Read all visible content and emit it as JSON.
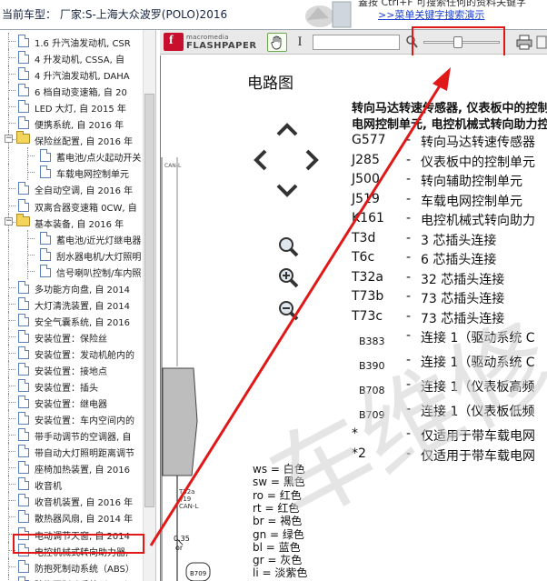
{
  "header": {
    "car_title": "当前车型：  厂家:S-上海大众波罗(POLO)2016",
    "hint_line": "蓋按 Ctrl+F  可搜索任何的资料关键字",
    "hint_link": ">>菜单关键字搜索演示"
  },
  "tree": {
    "items": [
      {
        "label": "1.6 升汽油发动机, CSR",
        "icon": "document-icon",
        "depth": 1
      },
      {
        "label": "4 升发动机, CSSA, 自",
        "icon": "document-icon",
        "depth": 1
      },
      {
        "label": "4 升汽油发动机, DAHA",
        "icon": "document-icon",
        "depth": 1
      },
      {
        "label": "6 档自动变速箱, 自 20",
        "icon": "document-icon",
        "depth": 1
      },
      {
        "label": "LED 大灯, 自 2015 年",
        "icon": "document-icon",
        "depth": 1
      },
      {
        "label": "便携系统, 自 2016 年",
        "icon": "document-icon",
        "depth": 1
      },
      {
        "label": "保险丝配置, 自 2016 年",
        "icon": "folder-icon",
        "depth": 0
      },
      {
        "label": "蓄电池/点火起动开关",
        "icon": "document-icon",
        "depth": 2
      },
      {
        "label": "车载电网控制单元",
        "icon": "document-icon",
        "depth": 2
      },
      {
        "label": "全自动空调, 自 2016 年",
        "icon": "document-icon",
        "depth": 1
      },
      {
        "label": "双离合器变速箱 0CW, 自",
        "icon": "document-icon",
        "depth": 1
      },
      {
        "label": "基本装备, 自 2016 年",
        "icon": "folder-icon",
        "depth": 0
      },
      {
        "label": "蓄电池/近光灯继电器",
        "icon": "document-icon",
        "depth": 2
      },
      {
        "label": "刮水器电机/大灯照明",
        "icon": "document-icon",
        "depth": 2
      },
      {
        "label": "信号喇叭控制/车内照",
        "icon": "document-icon",
        "depth": 2
      },
      {
        "label": "多功能方向盘, 自 2014",
        "icon": "document-icon",
        "depth": 1
      },
      {
        "label": "大灯清洗装置, 自 2014",
        "icon": "document-icon",
        "depth": 1
      },
      {
        "label": "安全气囊系统, 自 2016",
        "icon": "document-icon",
        "depth": 1
      },
      {
        "label": "安装位置：保险丝",
        "icon": "document-icon",
        "depth": 1
      },
      {
        "label": "安装位置：发动机舱内的",
        "icon": "document-icon",
        "depth": 1
      },
      {
        "label": "安装位置：接地点",
        "icon": "document-icon",
        "depth": 1
      },
      {
        "label": "安装位置：插头",
        "icon": "document-icon",
        "depth": 1
      },
      {
        "label": "安装位置：继电器",
        "icon": "document-icon",
        "depth": 1
      },
      {
        "label": "安装位置：车内空间内的",
        "icon": "document-icon",
        "depth": 1
      },
      {
        "label": "带手动调节的空调器, 自",
        "icon": "document-icon",
        "depth": 1
      },
      {
        "label": "带自动大灯照明距离调节",
        "icon": "document-icon",
        "depth": 1
      },
      {
        "label": "座椅加热装置, 自 2016",
        "icon": "document-icon",
        "depth": 1
      },
      {
        "label": "收音机",
        "icon": "document-icon",
        "depth": 1
      },
      {
        "label": "收音机装置, 自 2016 年",
        "icon": "document-icon",
        "depth": 1
      },
      {
        "label": "散热器风扇, 自 2014 年",
        "icon": "document-icon",
        "depth": 1
      },
      {
        "label": "电动调节天窗, 自 2014",
        "icon": "document-icon",
        "depth": 1
      },
      {
        "label": "电控机械式转向助力器,",
        "icon": "document-icon",
        "depth": 1,
        "selected": true
      },
      {
        "label": "防抱死制动系统（ABS）",
        "icon": "document-icon",
        "depth": 1
      },
      {
        "label": "防抱死制动系统（ABS）",
        "icon": "document-icon",
        "depth": 1
      }
    ]
  },
  "toolbar": {
    "brand_small": "macromedia",
    "brand_big": "FLASHPAPER",
    "logo_letter": "f",
    "hand_tool": "hand-icon",
    "text_tool": "I",
    "zoom_level": 0.43
  },
  "doc": {
    "title": "电路图",
    "heading_line1": "转向马达转速传感器, 仪表板中的控制单元中的",
    "heading_line2": "电网控制单元, 电控机械式转向助力控制单元",
    "legend": [
      {
        "code": "G577",
        "text": "转向马达转速传感器",
        "small": false
      },
      {
        "code": "J285",
        "text": "仪表板中的控制单元",
        "small": false
      },
      {
        "code": "J500",
        "text": "转向辅助控制单元",
        "small": false
      },
      {
        "code": "J519",
        "text": "车载电网控制单元",
        "small": false
      },
      {
        "code": "K161",
        "text": "电控机械式转向助力",
        "small": false
      },
      {
        "code": "T3d",
        "text": "3 芯插头连接",
        "small": false
      },
      {
        "code": "T6c",
        "text": "6 芯插头连接",
        "small": false
      },
      {
        "code": "T32a",
        "text": "32 芯插头连接",
        "small": false
      },
      {
        "code": "T73b",
        "text": "73 芯插头连接",
        "small": false
      },
      {
        "code": "T73c",
        "text": "73 芯插头连接",
        "small": false
      },
      {
        "code": "B383",
        "text": "连接 1（驱动系统 C",
        "small": true
      },
      {
        "code": "B390",
        "text": "连接 1（驱动系统 C",
        "small": true
      },
      {
        "code": "B708",
        "text": "连接 1（仪表板高频",
        "small": true
      },
      {
        "code": "B709",
        "text": "连接 1（仪表板低频",
        "small": true
      },
      {
        "code": "*",
        "text": "仅适用于带车载电网",
        "small": false
      },
      {
        "code": "*2",
        "text": "仅适用于带车载电网",
        "small": false
      }
    ],
    "colors": [
      "ws = 白色",
      "sw = 黑色",
      "ro = 红色",
      "rt = 红色",
      "br = 褐色",
      "gn = 绿色",
      "bl = 蓝色",
      "gr = 灰色",
      "li = 淡紫色"
    ],
    "diagram_labels": {
      "wire_size": "0.35",
      "wire_color": "or",
      "connector": "B709",
      "connector2": "T32a",
      "connector2_pin": "/19",
      "bus": "CAN-L"
    },
    "watermark": "车维修"
  },
  "colors": {
    "highlight": "#e01818",
    "link": "#1a3fd0",
    "folder": "#f4d55c",
    "doc_border": "#5a7fb8"
  }
}
